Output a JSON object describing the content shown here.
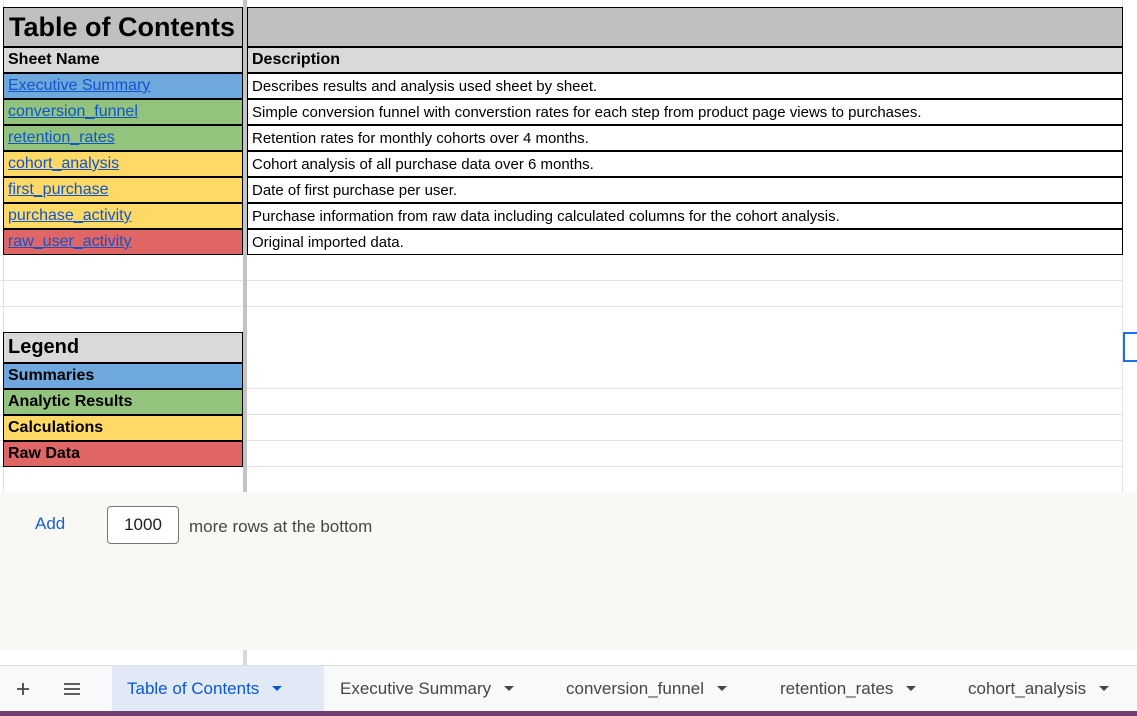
{
  "colors": {
    "summaries": "#6fa8dc",
    "analytic_results": "#93c47d",
    "calculations": "#ffd966",
    "raw_data": "#e06666",
    "header_gray": "#c0c0c0",
    "link_blue": "#1155cc"
  },
  "title": "Table of Contents",
  "columns": {
    "sheet_name": "Sheet Name",
    "description": "Description"
  },
  "toc_rows": [
    {
      "sheet": "Executive Summary",
      "description": "Describes results and analysis used sheet by sheet.",
      "category": "summaries"
    },
    {
      "sheet": "conversion_funnel",
      "description": "Simple conversion funnel with converstion rates for each step from product page views to purchases.",
      "category": "analytic_results"
    },
    {
      "sheet": "retention_rates",
      "description": "Retention rates for monthly cohorts over 4 months.",
      "category": "analytic_results"
    },
    {
      "sheet": "cohort_analysis",
      "description": "Cohort analysis of all purchase data over 6 months.",
      "category": "calculations"
    },
    {
      "sheet": "first_purchase",
      "description": "Date of first purchase per user.",
      "category": "calculations"
    },
    {
      "sheet": "purchase_activity",
      "description": "Purchase information from raw data including calculated columns for the cohort analysis.",
      "category": "calculations"
    },
    {
      "sheet": "raw_user_activity",
      "description": "Original imported data.",
      "category": "raw_data"
    }
  ],
  "legend": {
    "title": "Legend",
    "items": [
      {
        "label": "Summaries",
        "category": "summaries"
      },
      {
        "label": "Analytic Results",
        "category": "analytic_results"
      },
      {
        "label": "Calculations",
        "category": "calculations"
      },
      {
        "label": "Raw Data",
        "category": "raw_data"
      }
    ]
  },
  "add_rows": {
    "button": "Add",
    "count": "1000",
    "suffix": "more rows at the bottom"
  },
  "sheet_tabs": [
    {
      "label": "Table of Contents",
      "active": true
    },
    {
      "label": "Executive Summary",
      "active": false
    },
    {
      "label": "conversion_funnel",
      "active": false
    },
    {
      "label": "retention_rates",
      "active": false
    },
    {
      "label": "cohort_analysis",
      "active": false
    }
  ],
  "icons": {
    "add_sheet": "plus-icon",
    "all_sheets": "menu-icon"
  }
}
